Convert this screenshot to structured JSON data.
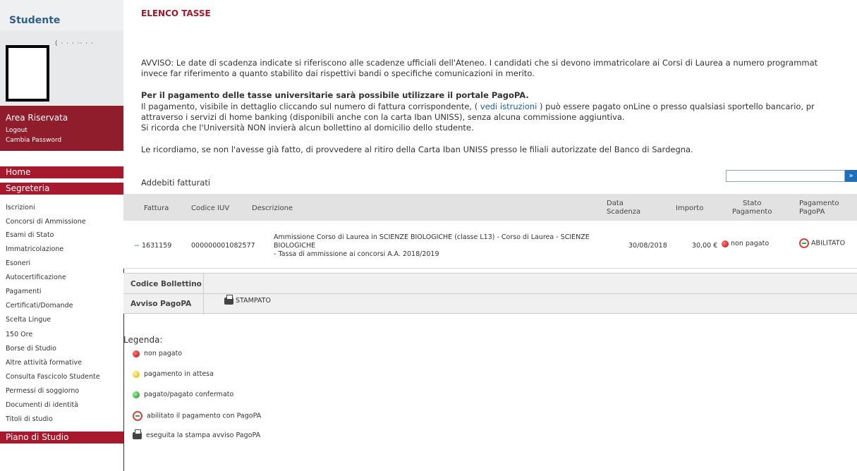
{
  "sidebar": {
    "title": "Studente",
    "user_name": "( · · ·  ·· · ·",
    "area": {
      "title": "Area Riservata",
      "links": [
        "Logout",
        "Cambia Password"
      ]
    },
    "home": "Home",
    "segreteria": "Segreteria",
    "items": [
      "Iscrizioni",
      "Concorsi di Ammissione",
      "Esami di Stato",
      "Immatricolazione",
      "Esoneri",
      "Autocertificazione",
      "Pagamenti",
      "Certificati/Domande",
      "Scelta Lingue",
      "150 Ore",
      "Borse di Studio",
      "Altre attività formative",
      "Consulta Fascicolo Studente",
      "Permessi di soggiorno",
      "Documenti di identità",
      "Titoli di studio"
    ],
    "piano": "Piano di Studio"
  },
  "main": {
    "title": "ELENCO TASSE",
    "notice_line1": "AVVISO: Le date di scadenza indicate si riferiscono alle scadenze ufficiali dell'Ateneo. I candidati che si devono immatricolare ai Corsi di Laurea a numero programmat",
    "notice_line2": "invece far riferimento a quanto stabilito dai rispettivi bandi o specifiche comunicazioni in merito.",
    "pagopa_heading": "Per il pagamento delle tasse universitarie sarà possibile utilizzare il portale PagoPA.",
    "pagopa_line1_a": "Il pagamento, visibile in dettaglio cliccando sul numero di fattura corrispondente, ( ",
    "pagopa_link": "vedi istruzioni",
    "pagopa_line1_b": " ) può essere pagato onLine o presso qualsiasi sportello bancario, pr",
    "pagopa_line2": "attraverso i servizi di home banking (disponibili anche con la carta Iban UNISS), senza alcuna commissione aggiuntiva.",
    "pagopa_line3": "Si ricorda che l'Università NON invierà alcun bollettino al domicilio dello studente.",
    "reminder": "Le ricordiamo, se non l'avesse già fatto, di provvedere al ritiro della Carta Iban UNISS presso le filiali autorizzate del Banco di Sardegna.",
    "search_button": "»",
    "section_title": "Addebiti fatturati",
    "table": {
      "headers": {
        "fattura": "Fattura",
        "iuv": "Codice IUV",
        "descrizione": "Descrizione",
        "scadenza_1": "Data",
        "scadenza_2": "Scadenza",
        "importo": "Importo",
        "stato_1": "Stato",
        "stato_2": "Pagamento",
        "pagopa_1": "Pagamento",
        "pagopa_2": "PagoPA"
      },
      "row": {
        "toggle": "−",
        "fattura": "1631159",
        "iuv": "000000001082577",
        "desc_1": "Ammissione Corso di Laurea in SCIENZE BIOLOGICHE (classe L13) - Corso di Laurea - SCIENZE",
        "desc_2": "BIOLOGICHE",
        "desc_3": "- Tassa di ammissione ai concorsi A.A. 2018/2019",
        "scadenza": "30/08/2018",
        "importo": "30,00 €",
        "stato": "non pagato",
        "pagopa": "ABILITATO"
      }
    },
    "detail": {
      "codice_label": "Codice Bollettino",
      "codice_value": "",
      "avviso_label": "Avviso PagoPA",
      "avviso_value": "STAMPATO"
    },
    "legend": {
      "title": "Legenda:",
      "items": [
        "non pagato",
        "pagamento in attesa",
        "pagato/pagato confermato",
        "abilitato il pagamento con PagoPA",
        "eseguita la stampa avviso PagoPA"
      ]
    }
  },
  "colors": {
    "brand_red": "#a8192e",
    "area_red": "#8f1d2b",
    "title_red": "#9c1b2b",
    "link_blue": "#1f5fa8",
    "side_title_blue": "#2f5f8a"
  }
}
